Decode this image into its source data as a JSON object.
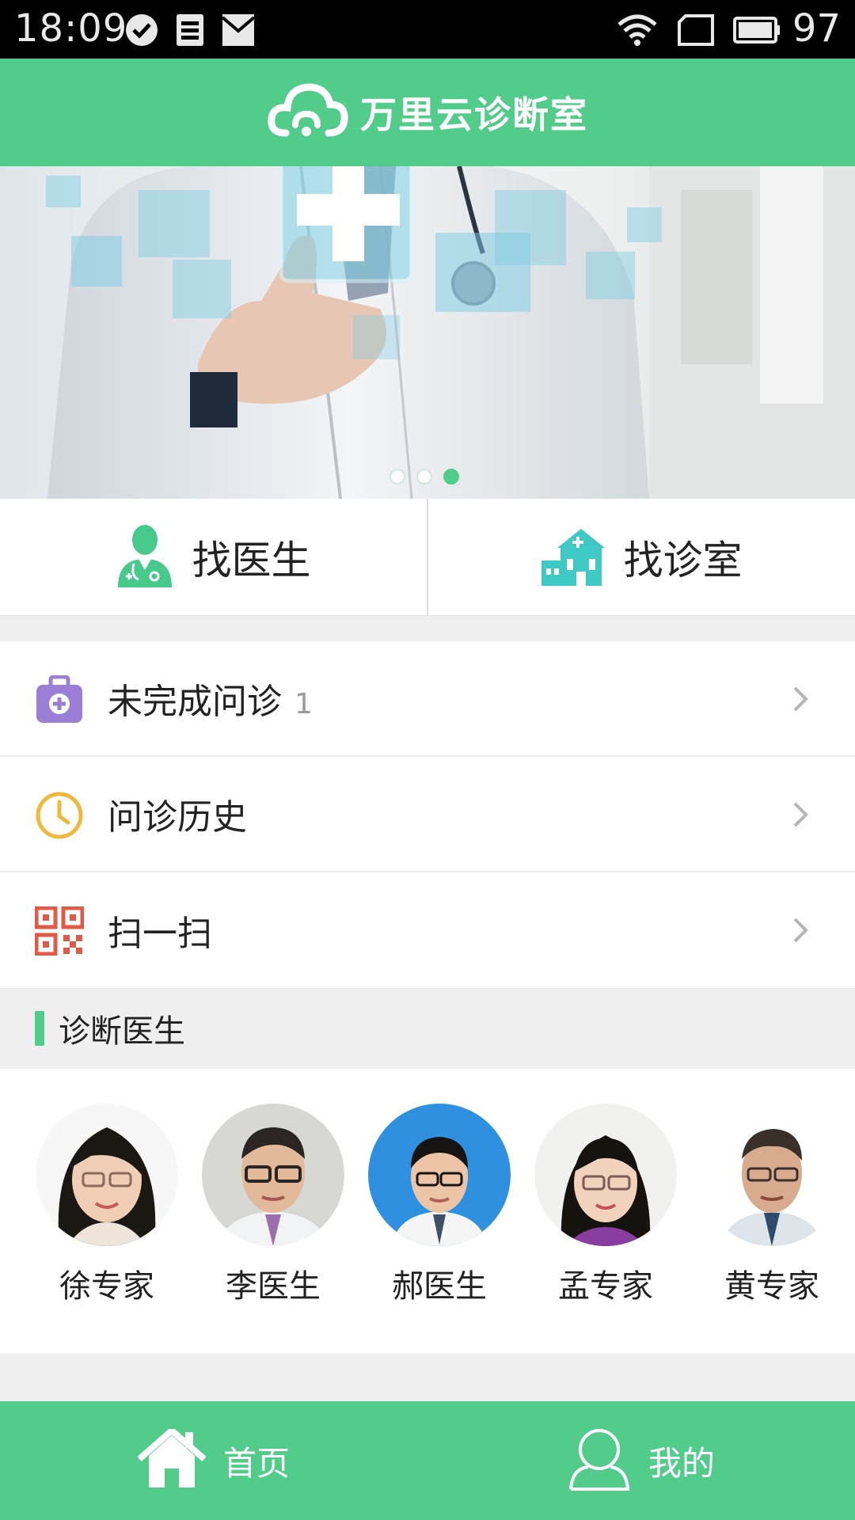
{
  "status_bar": {
    "time": "18:09",
    "battery": "97",
    "icons": [
      "check-circle-icon",
      "sim-card-icon",
      "mail-icon",
      "wifi-icon",
      "portrait-icon",
      "battery-icon"
    ]
  },
  "header": {
    "app_name": "万里云诊断室",
    "logo_icon": "cloud-logo-icon"
  },
  "banner": {
    "slides": 3,
    "active_slide": 3
  },
  "quick_actions": [
    {
      "label": "找医生",
      "icon": "doctor-icon"
    },
    {
      "label": "找诊室",
      "icon": "clinic-icon"
    }
  ],
  "menu": [
    {
      "label": "未完成问诊",
      "count": "1",
      "icon": "medical-kit-icon"
    },
    {
      "label": "问诊历史",
      "icon": "clock-icon"
    },
    {
      "label": "扫一扫",
      "icon": "qr-code-icon"
    }
  ],
  "section": {
    "title": "诊断医生"
  },
  "doctors": [
    {
      "name": "徐专家"
    },
    {
      "name": "李医生"
    },
    {
      "name": "郝医生"
    },
    {
      "name": "孟专家"
    },
    {
      "name": "黄专家"
    }
  ],
  "tabbar": [
    {
      "label": "首页",
      "icon": "home-icon"
    },
    {
      "label": "我的",
      "icon": "user-icon"
    }
  ],
  "colors": {
    "brand_green": "#52cc8a",
    "background": "#efefef",
    "text": "#222222",
    "muted": "#9a9a9a"
  }
}
